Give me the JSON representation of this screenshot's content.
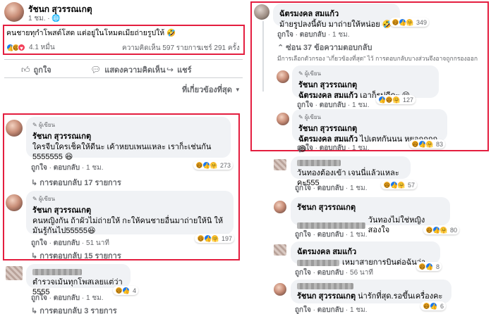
{
  "post": {
    "author": "รัชนก สุวรรณเกตุ",
    "time": "1 ชม.",
    "caption": "คนชายทุกำโพสต์โสด แต่อยู่ในโหมดเมียถ่ายรูปให้ 🤣",
    "reaction_count": "4.1 หมื่น",
    "comments_count": "ความคิดเห็น 597 รายการ",
    "shares_count": "แชร์ 291 ครั้ง",
    "actions": {
      "like": "ถูกใจ",
      "comment": "แสดงความคิดเห็น",
      "share": "แชร์"
    },
    "sort": "ที่เกี่ยวข้องที่สุด"
  },
  "left_comments": [
    {
      "tag": "ผู้เขียน",
      "author": "รัชนก สุวรรณเกตุ",
      "text": "ใครจีบใครเช็คให้ดีนะ เค้าหยบเพนแหละ เราก็ะเช่นกัน 5555555 😆",
      "like": "ถูกใจ",
      "reply": "ตอบกลับ",
      "time": "1 ชม.",
      "reactions": "273",
      "replies": "การตอบกลับ 17 รายการ"
    },
    {
      "tag": "ผู้เขียน",
      "author": "รัชนก สุวรรณเกตุ",
      "text": "คนหญิงกัน ถ้าผัวไม่ถ่ายให้ กะให้คนชายอื่นมาถ่ายให้นิ ให้มันรู้กันไป55555😆",
      "like": "ถูกใจ",
      "reply": "ตอบกลับ",
      "time": "51 นาที",
      "reactions": "197",
      "replies": "การตอบกลับ 15 รายการ"
    },
    {
      "text": "ตำรวจเม้นทุกโพสเลยแต่ว่า 5555",
      "like": "ถูกใจ",
      "reply": "ตอบกลับ",
      "time": "1 ชม.",
      "reactions": "4",
      "replies": "การตอบกลับ 3 รายการ"
    }
  ],
  "right_top": {
    "author": "ฉัตรมงคล สมแก้ว",
    "text": "ม้ายรูปลงนี้ดับ มาถ่ายให้หน่อย 🤣",
    "like": "ถูกใจ",
    "reply": "ตอบกลับ",
    "time": "1 ชม.",
    "reactions": "349",
    "hide_replies": "ซ่อน 37 ข้อความตอบกลับ",
    "filter_note": "มีการเลือกตัวกรอง \"เกี่ยวข้องที่สุด\" ไว้ การตอบกลับบางส่วนจึงอาจถูกกรองออก",
    "replies": [
      {
        "tag": "ผู้เขียน",
        "author": "รัชนก สุวรรณเกตุ",
        "mention": "ฉัตรมงคล สมแก้ว",
        "text": "เอาก็รูปดีดะ 😆",
        "like": "ถูกใจ",
        "reply": "ตอบกลับ",
        "time": "1 ชม.",
        "reactions": "127"
      },
      {
        "tag": "ผู้เขียน",
        "author": "รัชนก สุวรรณเกตุ",
        "mention": "ฉัตรมงคล สมแก้ว",
        "text": "ไปเตทกันนน หยอกกกก😆",
        "like": "ถูกใจ",
        "reply": "ตอบกลับ",
        "time": "1 ชม.",
        "reactions": "83"
      }
    ]
  },
  "right_bottom": [
    {
      "text": "วันทองต้องเข้า เจนนี่แล้วแหละคะ555",
      "like": "ถูกใจ",
      "reply": "ตอบกลับ",
      "time": "1 ชม.",
      "reactions": "57"
    },
    {
      "author": "รัชนก สุวรรณเกตุ",
      "text": "วันทองไม่ใช่หญิงสองใจ",
      "like": "ถูกใจ",
      "reply": "ตอบกลับ",
      "time": "1 ชม.",
      "reactions": "80"
    },
    {
      "author": "ฉัตรมงคล สมแก้ว",
      "text": "เหมาสายการบินต่อฉันว่า",
      "like": "ถูกใจ",
      "reply": "ตอบกลับ",
      "time": "56 นาที",
      "reactions": "8"
    },
    {
      "author": "รัชนก สุวรรณเกตุ",
      "text": "น่ารักที่สุด.รอขึ้นเครื่องคะ",
      "like": "ถูกใจ",
      "reply": "ตอบกลับ",
      "time": "1 ชม.",
      "reactions": "6"
    }
  ]
}
